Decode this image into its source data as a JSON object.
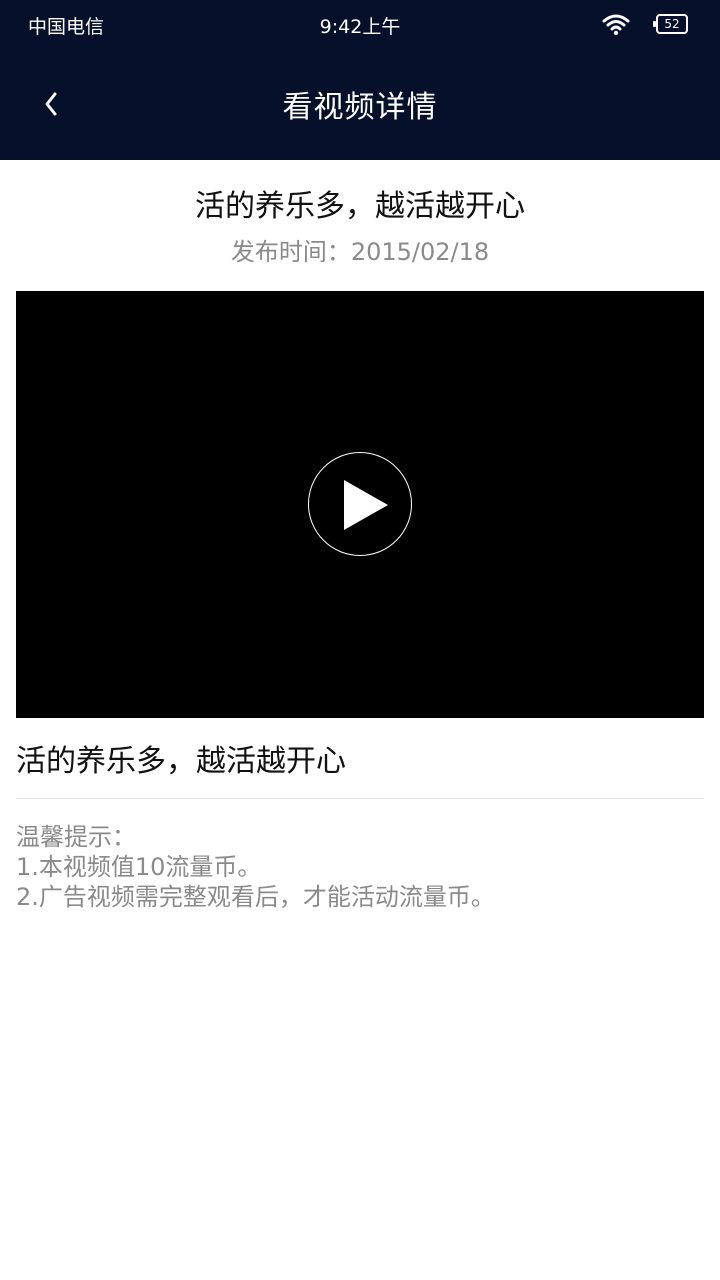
{
  "status_bar": {
    "carrier": "中国电信",
    "time": "9:42上午",
    "battery": "52"
  },
  "nav": {
    "title": "看视频详情"
  },
  "video": {
    "title": "活的养乐多，越活越开心",
    "publish_label": "发布时间：",
    "publish_date": "2015/02/18",
    "caption": "活的养乐多，越活越开心"
  },
  "tips": {
    "heading": "温馨提示：",
    "lines": [
      "1.本视频值10流量币。",
      "2.广告视频需完整观看后，才能活动流量币。"
    ]
  },
  "colors": {
    "header_bg": "#06102a",
    "secondary_text": "#8a8a8a"
  }
}
